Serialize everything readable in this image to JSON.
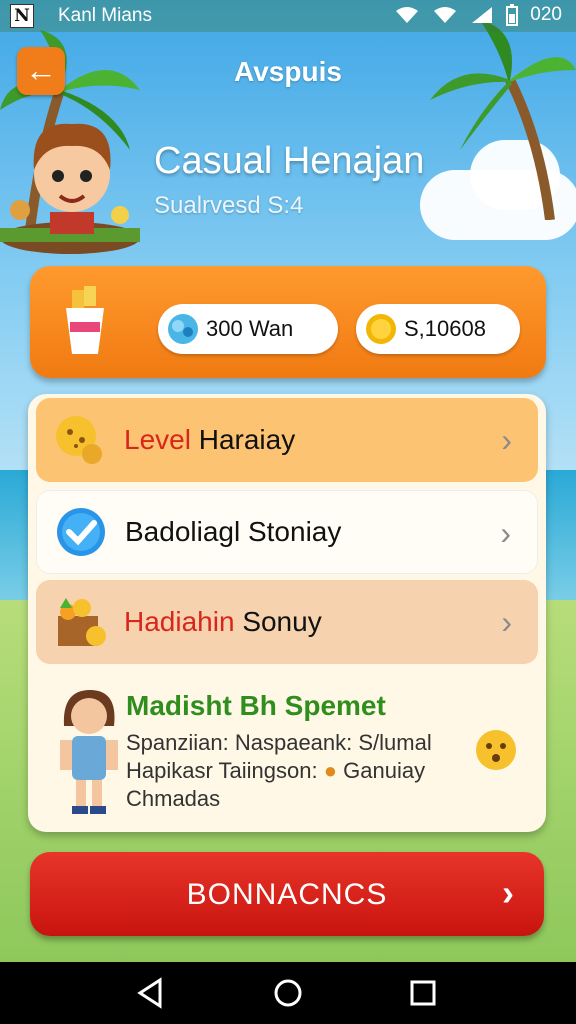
{
  "status_bar": {
    "carrier": "Kanl Mians",
    "time": "020"
  },
  "header": {
    "title": "Avspuis",
    "back_icon": "arrow-left-icon"
  },
  "game": {
    "title": "Casual Henajan",
    "subtitle": "Sualrvesd S:4"
  },
  "currency": {
    "gems": "300 Wan",
    "coins": "S,10608"
  },
  "menu": [
    {
      "label_part1": "Level",
      "label_part2": "Haraiay"
    },
    {
      "label_part1": "",
      "label_part2": "Badoliagl Stoniay"
    },
    {
      "label_part1": "Hadiahin",
      "label_part2": "Sonuy"
    }
  ],
  "info": {
    "title": "Madisht Bh Spemet",
    "line1": "Spanziian: Naspaeank: S/lumal",
    "line2a": "Hapikasr Taiingson:",
    "line2b": "Ganuiay",
    "line3": "Chmadas"
  },
  "bonus_button": {
    "label": "BONNACNCS"
  },
  "colors": {
    "accent_orange": "#f07d1a",
    "bonus_red": "#d9261c",
    "green_text": "#2f8e1d"
  }
}
